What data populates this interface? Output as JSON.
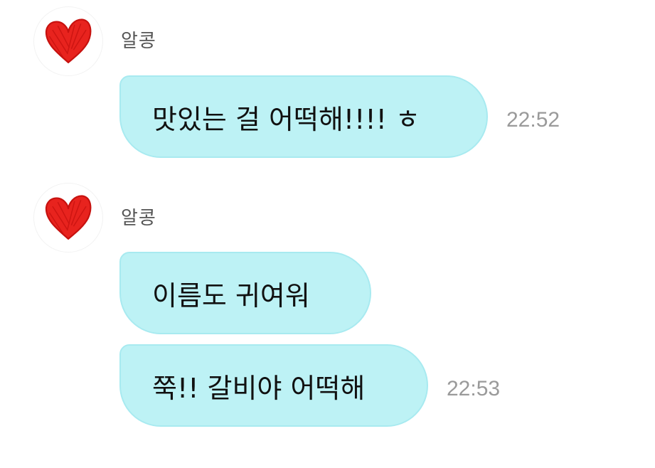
{
  "groups": [
    {
      "sender": "알콩",
      "avatar_icon": "red-heart-icon",
      "messages": [
        {
          "text": "맛있는 걸 어떡해!!!! ㅎ",
          "time": "22:52"
        }
      ]
    },
    {
      "sender": "알콩",
      "avatar_icon": "red-heart-icon",
      "messages": [
        {
          "text": "이름도 귀여워",
          "time": ""
        },
        {
          "text": "쭉!! 갈비야 어떡해",
          "time": "22:53"
        }
      ]
    }
  ],
  "colors": {
    "bubble": "#bdf2f5",
    "bubble_border": "#a8eaf0",
    "heart": "#e8231e",
    "time": "#9a9a9a",
    "sender": "#555555"
  }
}
